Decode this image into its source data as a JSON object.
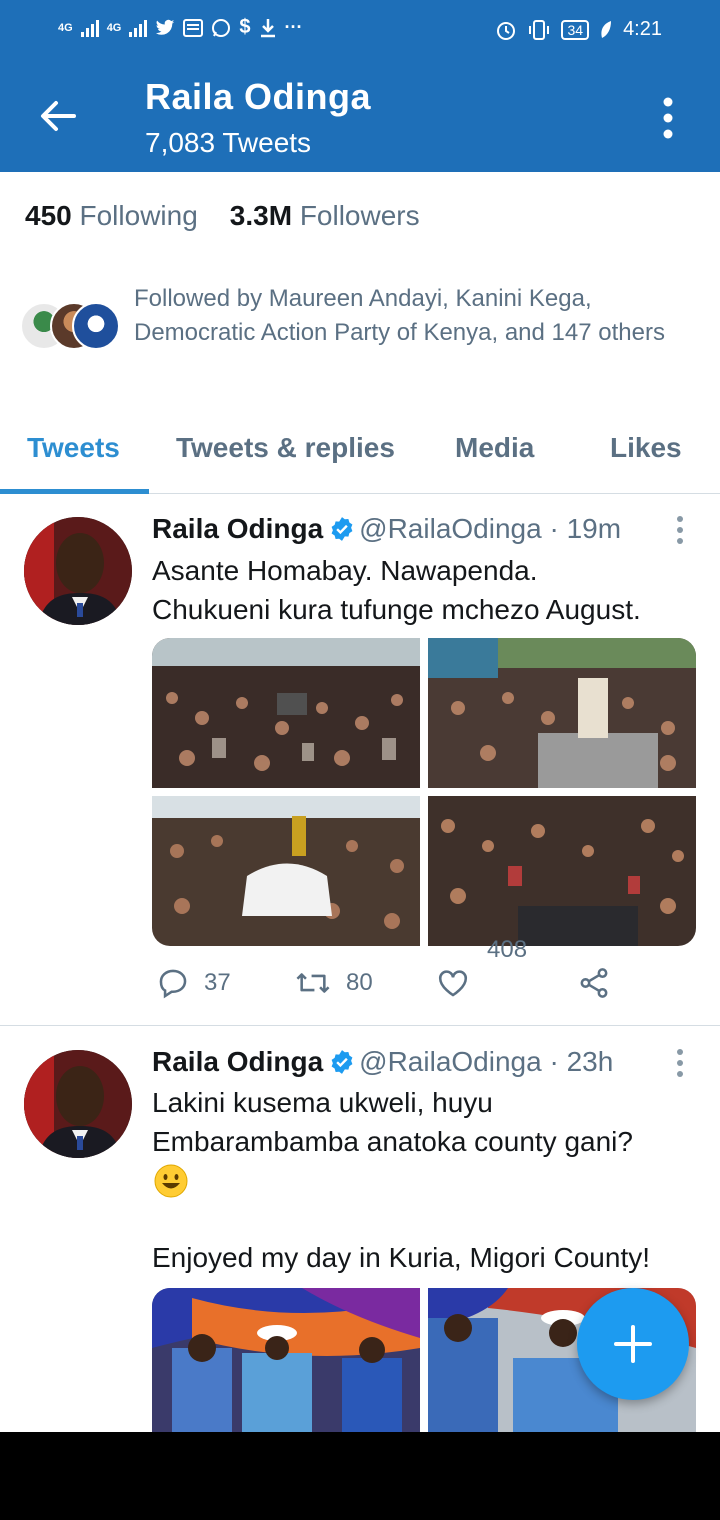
{
  "status_bar": {
    "network_1": "4G",
    "network_2": "4G",
    "battery": "34",
    "time": "4:21"
  },
  "header": {
    "title": "Raila Odinga",
    "subtitle": "7,083 Tweets"
  },
  "stats": {
    "following_count": "450",
    "following_label": "Following",
    "followers_count": "3.3M",
    "followers_label": "Followers"
  },
  "followed_by": "Followed by Maureen Andayi, Kanini Kega, Democratic Action Party of Kenya, and 147 others",
  "tabs": [
    {
      "label": "Tweets",
      "active": true
    },
    {
      "label": "Tweets & replies",
      "active": false
    },
    {
      "label": "Media",
      "active": false
    },
    {
      "label": "Likes",
      "active": false
    }
  ],
  "tweets": [
    {
      "name": "Raila Odinga",
      "handle": "@RailaOdinga",
      "time": "· 19m",
      "text": "Asante Homabay. Nawapenda.\nChukueni kura tufunge mchezo August.",
      "replies": "37",
      "retweets": "80",
      "likes": "408"
    },
    {
      "name": "Raila Odinga",
      "handle": "@RailaOdinga",
      "time": "· 23h",
      "text_line1": "Lakini kusema ukweli, huyu",
      "text_line2": "Embarambamba anatoka county gani?",
      "text_line3": "Enjoyed my day in Kuria, Migori County!"
    }
  ],
  "colors": {
    "header_bg": "#1e6fb8",
    "accent": "#2d8ed1",
    "fab": "#1d9bf0",
    "muted": "#5b7083"
  },
  "icons": [
    "back-arrow-icon",
    "kebab-icon",
    "verified-icon",
    "reply-icon",
    "retweet-icon",
    "like-icon",
    "share-icon",
    "compose-icon"
  ]
}
